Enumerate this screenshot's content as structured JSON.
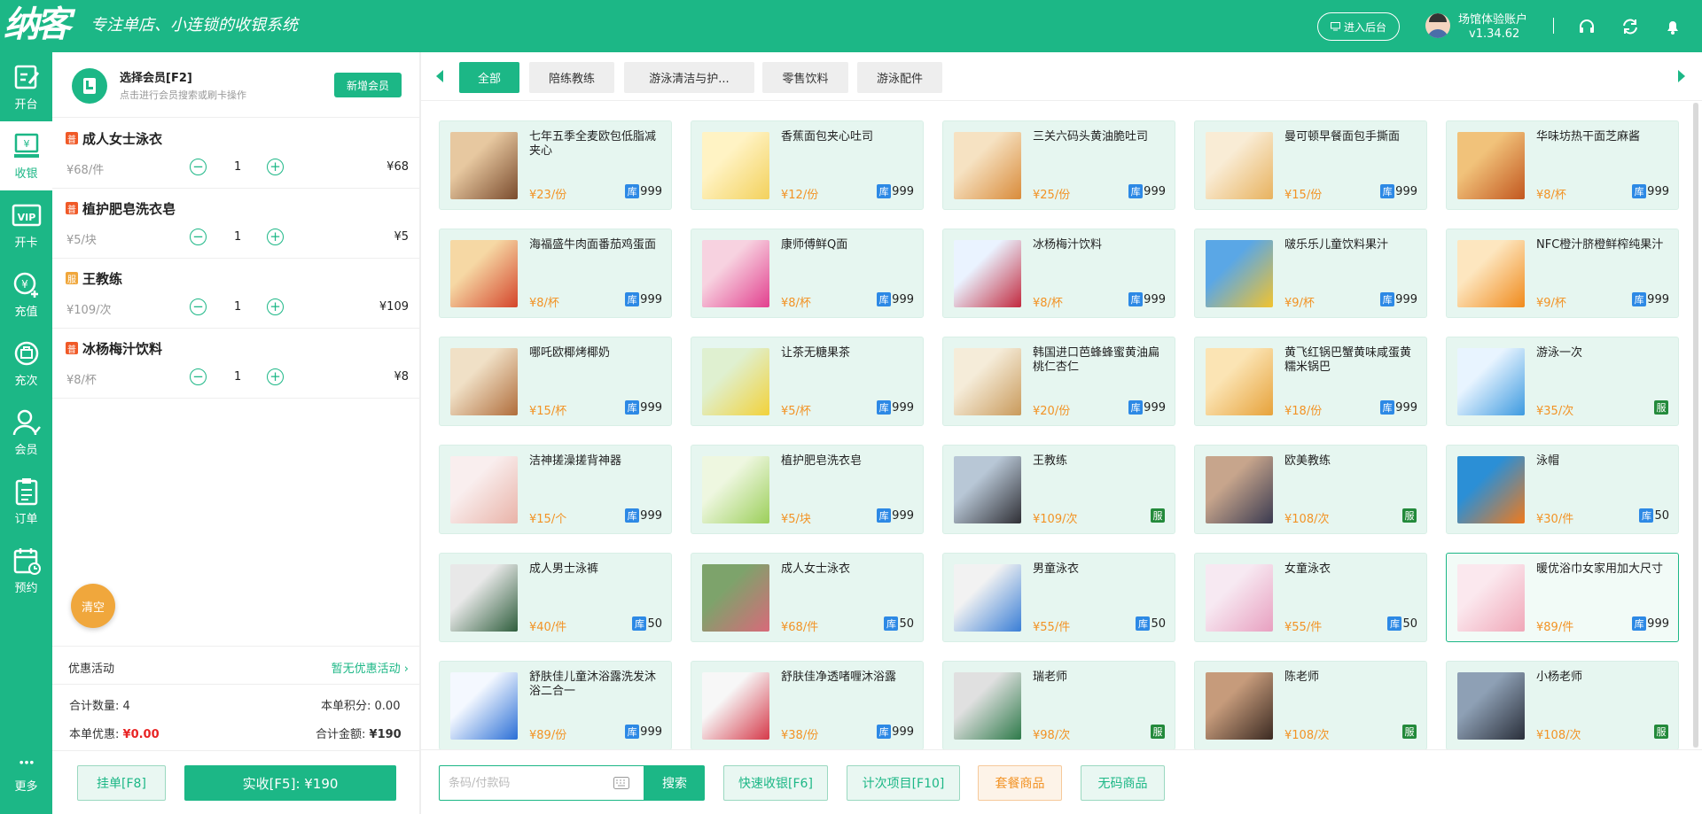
{
  "header": {
    "brand": "纳客",
    "slogan": "专注单店、小连锁的收银系统",
    "backend_label": "进入后台",
    "account": "场馆体验账户",
    "version": "v1.34.62"
  },
  "sidenav": [
    {
      "label": "开台",
      "icon": "table-edit-icon"
    },
    {
      "label": "收银",
      "icon": "cashier-icon",
      "active": true
    },
    {
      "label": "开卡",
      "icon": "vip-card-icon"
    },
    {
      "label": "充值",
      "icon": "recharge-icon"
    },
    {
      "label": "充次",
      "icon": "recharge-times-icon"
    },
    {
      "label": "会员",
      "icon": "member-icon"
    },
    {
      "label": "订单",
      "icon": "order-icon"
    },
    {
      "label": "预约",
      "icon": "appointment-icon"
    },
    {
      "label": "更多",
      "icon": "more-icon"
    }
  ],
  "member": {
    "title": "选择会员[F2]",
    "subtitle": "点击进行会员搜索或刷卡操作",
    "new_member": "新增会员"
  },
  "cart": [
    {
      "badge": "普",
      "badge_color": "#f05a28",
      "name": "成人女士泳衣",
      "price": "¥68/件",
      "minus": "−",
      "qty": "1",
      "plus": "+",
      "total": "¥68"
    },
    {
      "badge": "普",
      "badge_color": "#f05a28",
      "name": "植护肥皂洗衣皂",
      "price": "¥5/块",
      "minus": "−",
      "qty": "1",
      "plus": "+",
      "total": "¥5"
    },
    {
      "badge": "服",
      "badge_color": "#f0a73c",
      "name": "王教练",
      "price": "¥109/次",
      "minus": "−",
      "qty": "1",
      "plus": "+",
      "total": "¥109"
    },
    {
      "badge": "普",
      "badge_color": "#f05a28",
      "name": "冰杨梅汁饮料",
      "price": "¥8/杯",
      "minus": "−",
      "qty": "1",
      "plus": "+",
      "total": "¥8"
    }
  ],
  "clear_label": "清空",
  "promo": {
    "label": "优惠活动",
    "value": "暂无优惠活动 ›"
  },
  "summary": {
    "qty_label": "合计数量:",
    "qty_value": "4",
    "points_label": "本单积分:",
    "points_value": "0.00",
    "discount_label": "本单优惠:",
    "discount_value": "¥0.00",
    "total_label": "合计金额:",
    "total_value": "¥190"
  },
  "footer_left": {
    "hang": "挂单[F8]",
    "pay": "实收[F5]: ¥190"
  },
  "categories": [
    "全部",
    "陪练教练",
    "游泳清洁与护...",
    "零售饮料",
    "游泳配件"
  ],
  "products": [
    {
      "name": "七年五季全麦欧包低脂减夹心",
      "price": "¥23/份",
      "tag": "库",
      "stock": "999",
      "thumb": [
        "#7a4b2d",
        "#e7c8a0"
      ]
    },
    {
      "name": "香蕉面包夹心吐司",
      "price": "¥12/份",
      "tag": "库",
      "stock": "999",
      "thumb": [
        "#f3d15c",
        "#fff3c4"
      ]
    },
    {
      "name": "三关六码头黄油脆吐司",
      "price": "¥25/份",
      "tag": "库",
      "stock": "999",
      "thumb": [
        "#d98b3a",
        "#f6e2c2"
      ]
    },
    {
      "name": "曼可顿早餐面包手撕面",
      "price": "¥15/份",
      "tag": "库",
      "stock": "999",
      "thumb": [
        "#e8b25e",
        "#f9ecd5"
      ]
    },
    {
      "name": "华味坊热干面芝麻酱",
      "price": "¥8/杯",
      "tag": "库",
      "stock": "999",
      "thumb": [
        "#c2571f",
        "#f1c27a"
      ]
    },
    {
      "name": "海福盛牛肉面番茄鸡蛋面",
      "price": "¥8/杯",
      "tag": "库",
      "stock": "999",
      "thumb": [
        "#d4452b",
        "#f6d8a4"
      ]
    },
    {
      "name": "康师傅鲜Q面",
      "price": "¥8/杯",
      "tag": "库",
      "stock": "999",
      "thumb": [
        "#e2408e",
        "#f7d2e0"
      ]
    },
    {
      "name": "冰杨梅汁饮料",
      "price": "¥8/杯",
      "tag": "库",
      "stock": "999",
      "thumb": [
        "#c22a3f",
        "#eaf3ff"
      ]
    },
    {
      "name": "啵乐乐儿童饮料果汁",
      "price": "¥9/杯",
      "tag": "库",
      "stock": "999",
      "thumb": [
        "#f2c32e",
        "#5aa7e6"
      ]
    },
    {
      "name": "NFC橙汁脐橙鲜榨纯果汁",
      "price": "¥9/杯",
      "tag": "库",
      "stock": "999",
      "thumb": [
        "#f08a1c",
        "#fde6bf"
      ]
    },
    {
      "name": "哪吒欧椰烤椰奶",
      "price": "¥15/杯",
      "tag": "库",
      "stock": "999",
      "thumb": [
        "#b06d3b",
        "#f0e0c6"
      ]
    },
    {
      "name": "让茶无糖果茶",
      "price": "¥5/杯",
      "tag": "库",
      "stock": "999",
      "thumb": [
        "#f2d23a",
        "#dff0d0"
      ]
    },
    {
      "name": "韩国进口芭蜂蜂蜜黄油扁桃仁杏仁",
      "price": "¥20/份",
      "tag": "库",
      "stock": "999",
      "thumb": [
        "#c99a5b",
        "#f5ecd9"
      ]
    },
    {
      "name": "黄飞红锅巴蟹黄味咸蛋黄糯米锅巴",
      "price": "¥18/份",
      "tag": "库",
      "stock": "999",
      "thumb": [
        "#e7a23a",
        "#fbe4b4"
      ]
    },
    {
      "name": "游泳一次",
      "price": "¥35/次",
      "tag": "服",
      "stock": "",
      "thumb": [
        "#3d9ae0",
        "#e8f4ff"
      ]
    },
    {
      "name": "洁神搓澡搓背神器",
      "price": "¥15/个",
      "tag": "库",
      "stock": "999",
      "thumb": [
        "#e9b3a8",
        "#f9eeee"
      ]
    },
    {
      "name": "植护肥皂洗衣皂",
      "price": "¥5/块",
      "tag": "库",
      "stock": "999",
      "thumb": [
        "#9ccf5a",
        "#eef7e0"
      ]
    },
    {
      "name": "王教练",
      "price": "¥109/次",
      "tag": "服",
      "stock": "",
      "thumb": [
        "#2f2f35",
        "#b8c7d6"
      ]
    },
    {
      "name": "欧美教练",
      "price": "¥108/次",
      "tag": "服",
      "stock": "",
      "thumb": [
        "#3a3a50",
        "#c7a58c"
      ]
    },
    {
      "name": "泳帽",
      "price": "¥30/件",
      "tag": "库",
      "stock": "50",
      "thumb": [
        "#f07a1c",
        "#2b8fd6"
      ]
    },
    {
      "name": "成人男士泳裤",
      "price": "¥40/件",
      "tag": "库",
      "stock": "50",
      "thumb": [
        "#2f5e3d",
        "#e8e8e8"
      ]
    },
    {
      "name": "成人女士泳衣",
      "price": "¥68/件",
      "tag": "库",
      "stock": "50",
      "thumb": [
        "#d86a7a",
        "#7da36b"
      ]
    },
    {
      "name": "男童泳衣",
      "price": "¥55/件",
      "tag": "库",
      "stock": "50",
      "thumb": [
        "#3a7ed6",
        "#f2f2f2"
      ]
    },
    {
      "name": "女童泳衣",
      "price": "¥55/件",
      "tag": "库",
      "stock": "50",
      "thumb": [
        "#e8a0c0",
        "#f7e9f2"
      ]
    },
    {
      "name": "暖优浴巾女家用加大尺寸",
      "price": "¥89/件",
      "tag": "库",
      "stock": "999",
      "thumb": [
        "#f0a7b8",
        "#fbe8ee"
      ],
      "selected": true
    },
    {
      "name": "舒肤佳儿童沐浴露洗发沐浴二合一",
      "price": "¥89/份",
      "tag": "库",
      "stock": "999",
      "thumb": [
        "#2b6fd6",
        "#f4f8ff"
      ]
    },
    {
      "name": "舒肤佳净透啫喱沐浴露",
      "price": "¥38/份",
      "tag": "库",
      "stock": "999",
      "thumb": [
        "#d63a4a",
        "#f7f7f7"
      ]
    },
    {
      "name": "瑞老师",
      "price": "¥98/次",
      "tag": "服",
      "stock": "",
      "thumb": [
        "#2e7a4a",
        "#e0e0e0"
      ]
    },
    {
      "name": "陈老师",
      "price": "¥108/次",
      "tag": "服",
      "stock": "",
      "thumb": [
        "#3b2a22",
        "#c69b7b"
      ]
    },
    {
      "name": "小杨老师",
      "price": "¥108/次",
      "tag": "服",
      "stock": "",
      "thumb": [
        "#2a2f3a",
        "#8ea0b5"
      ]
    }
  ],
  "bottom": {
    "search_placeholder": "条码/付款码",
    "search_btn": "搜索",
    "quick": "快速收银[F6]",
    "times": "计次项目[F10]",
    "package": "套餐商品",
    "nocode": "无码商品"
  },
  "colors": {
    "primary": "#1cb786",
    "price": "#f29325",
    "stock_tag": "#2d89e5",
    "service_tag": "#238a3b",
    "discount": "#e82424"
  }
}
